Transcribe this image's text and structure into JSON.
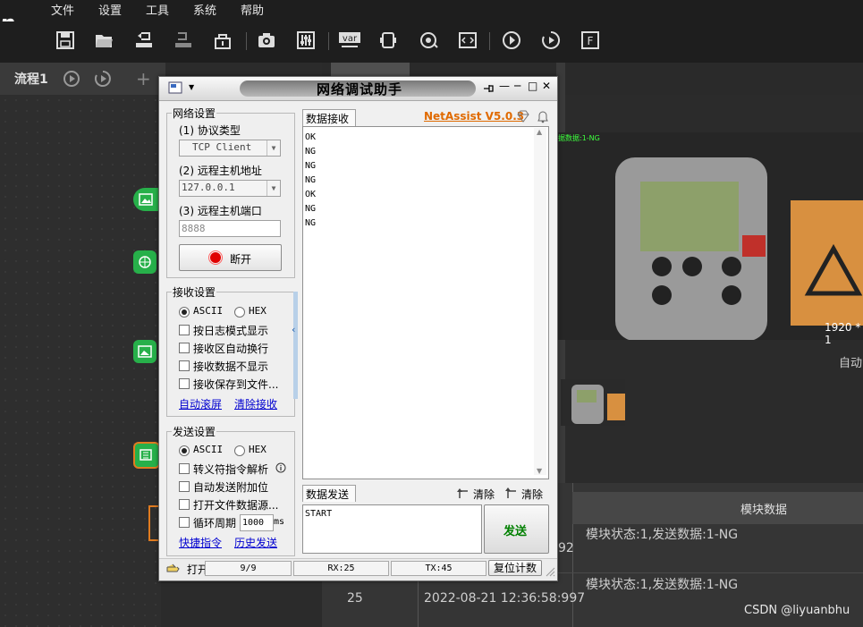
{
  "app": {
    "menu": [
      "文件",
      "设置",
      "工具",
      "系统",
      "帮助"
    ],
    "logo_fragment": "n",
    "flow_tab": "流程1",
    "add_symbol": "+",
    "image_resolution": "1920 * 1",
    "image_overlay_text": "据数据:1-NG",
    "auto_label": "自动",
    "table": {
      "header": "模块数据",
      "rows": [
        {
          "index": "",
          "time": "92",
          "data": "模块状态:1,发送数据:1-NG"
        },
        {
          "index": "25",
          "time": "2022-08-21 12:36:58:997",
          "data": "模块状态:1,发送数据:1-NG"
        }
      ]
    },
    "watermark": "CSDN @liyuanbhu"
  },
  "dialog": {
    "title": "网络调试助手",
    "brand": "NetAssist V5.0.3",
    "net_settings": {
      "title": "网络设置",
      "protocol_label": "(1) 协议类型",
      "protocol_value": "TCP Client",
      "host_label": "(2) 远程主机地址",
      "host_value": "127.0.0.1",
      "port_label": "(3) 远程主机端口",
      "port_value": "8888",
      "disconnect_button": "断开"
    },
    "recv_settings": {
      "title": "接收设置",
      "ascii": "ASCII",
      "hex": "HEX",
      "options": [
        "按日志模式显示",
        "接收区自动换行",
        "接收数据不显示",
        "接收保存到文件..."
      ],
      "auto_scroll": "自动滚屏",
      "clear_recv": "清除接收"
    },
    "send_settings": {
      "title": "发送设置",
      "ascii": "ASCII",
      "hex": "HEX",
      "options": [
        "转义符指令解析",
        "自动发送附加位",
        "打开文件数据源...",
        "循环周期"
      ],
      "cycle_value": "1000",
      "cycle_unit": "ms",
      "shortcuts": "快捷指令",
      "history": "历史发送"
    },
    "recv_tab": "数据接收",
    "recv_lines": [
      "OK",
      "NG",
      "NG",
      "NG",
      "OK",
      "NG",
      "NG"
    ],
    "send_tab": "数据发送",
    "clear_label_1": "清除",
    "clear_label_2": "清除",
    "send_text": "START",
    "send_button": "发送",
    "status": {
      "open_label": "打开",
      "count": "9/9",
      "rx": "RX:25",
      "tx": "TX:45",
      "reset": "复位计数"
    }
  },
  "colors": {
    "brand": "#e06a00",
    "send_button_text": "#008000",
    "node_green": "#27b04a",
    "link_blue": "#0000d0"
  }
}
